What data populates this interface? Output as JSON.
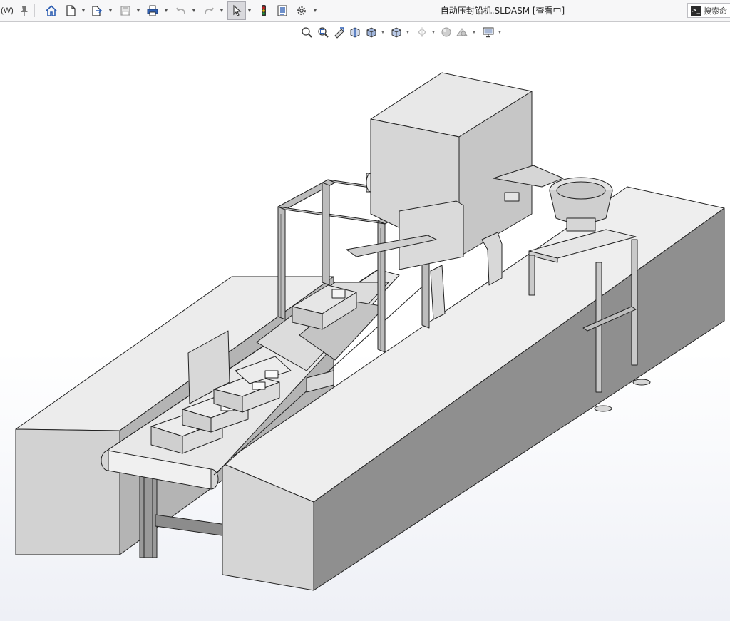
{
  "menu": {
    "w_label": "(W)"
  },
  "document": {
    "title": "自动压封铅机.SLDASM [查看中]"
  },
  "search": {
    "label": "搜索命"
  },
  "icons": {
    "pin": "pin-icon",
    "home": "home-icon",
    "new": "new-document-icon",
    "open": "open-file-icon",
    "save": "save-icon",
    "print": "print-icon",
    "undo": "undo-icon",
    "redo": "redo-icon",
    "select": "select-pointer-icon",
    "rebuild": "rebuild-traffic-light-icon",
    "file_properties": "file-properties-icon",
    "options": "gear-icon",
    "search": "command-search-icon"
  },
  "heads_up_toolbar": [
    "zoom-to-fit-icon",
    "zoom-to-area-icon",
    "previous-view-icon",
    "section-view-icon",
    "dynamic-annotation-icon",
    "view-orientation-icon",
    "display-style-icon",
    "hide-show-items-icon",
    "edit-appearance-icon",
    "apply-scene-icon",
    "view-settings-icon"
  ],
  "colors": {
    "toolbar_bg": "#f7f7f8",
    "model_light": "#e4e4e4",
    "model_mid": "#bdbdbd",
    "model_dark": "#7d7d7d",
    "edge": "#222222",
    "accent_red": "#d11f1f",
    "accent_blue": "#2f5fb3"
  }
}
